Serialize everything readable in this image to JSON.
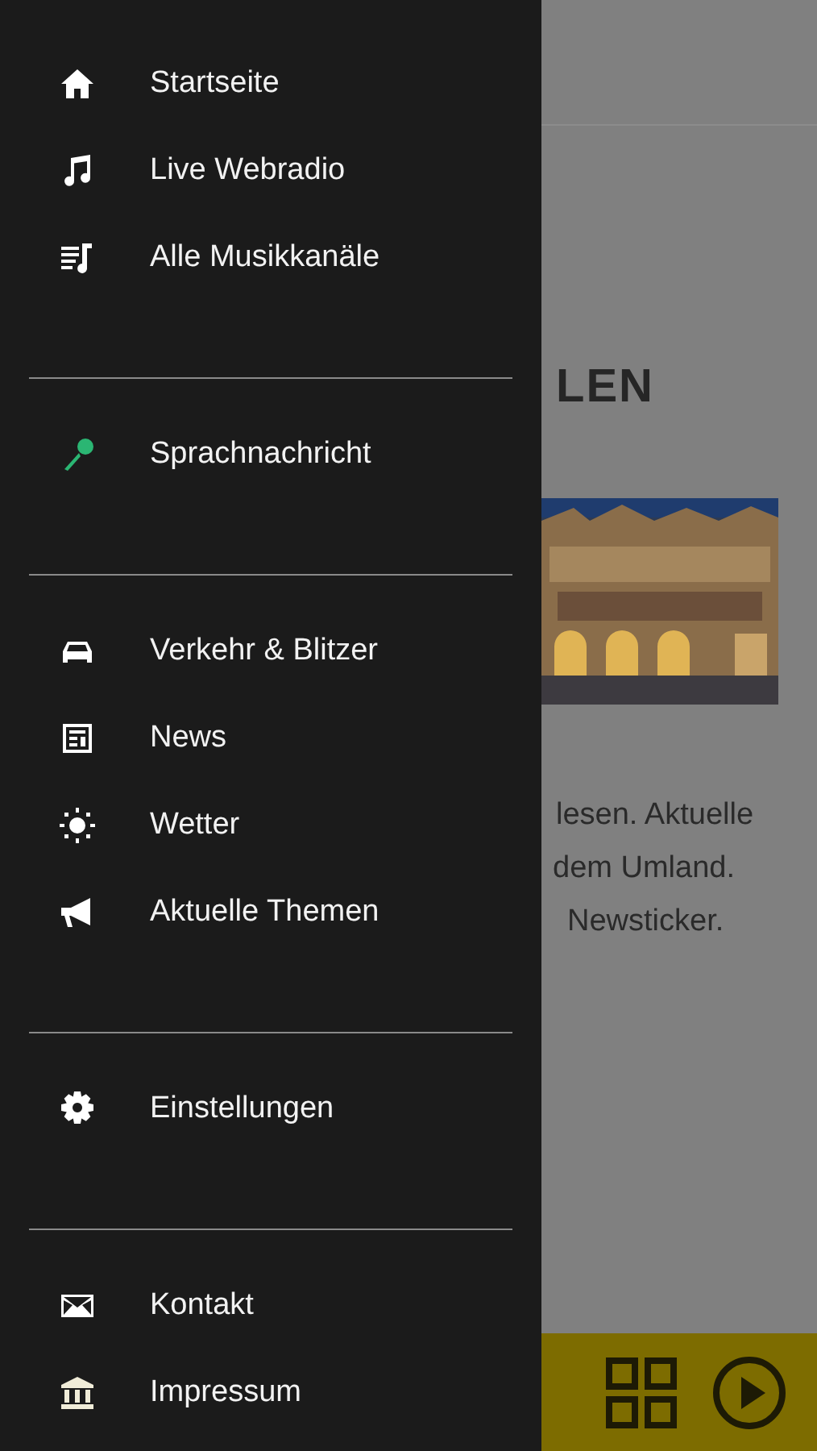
{
  "drawer": {
    "sections": [
      {
        "items": [
          {
            "label": "Startseite"
          },
          {
            "label": "Live Webradio"
          },
          {
            "label": "Alle Musikkanäle"
          }
        ]
      },
      {
        "items": [
          {
            "label": "Sprachnachricht"
          }
        ]
      },
      {
        "items": [
          {
            "label": "Verkehr & Blitzer"
          },
          {
            "label": "News"
          },
          {
            "label": "Wetter"
          },
          {
            "label": "Aktuelle Themen"
          }
        ]
      },
      {
        "items": [
          {
            "label": "Einstellungen"
          }
        ]
      },
      {
        "items": [
          {
            "label": "Kontakt"
          },
          {
            "label": "Impressum"
          }
        ]
      }
    ]
  },
  "content": {
    "headline_fragment": "LEN",
    "photo": {
      "kind": "picture"
    },
    "text_fragments": [
      "lesen. Aktuelle",
      "dem Umland.",
      "Newsticker."
    ]
  }
}
